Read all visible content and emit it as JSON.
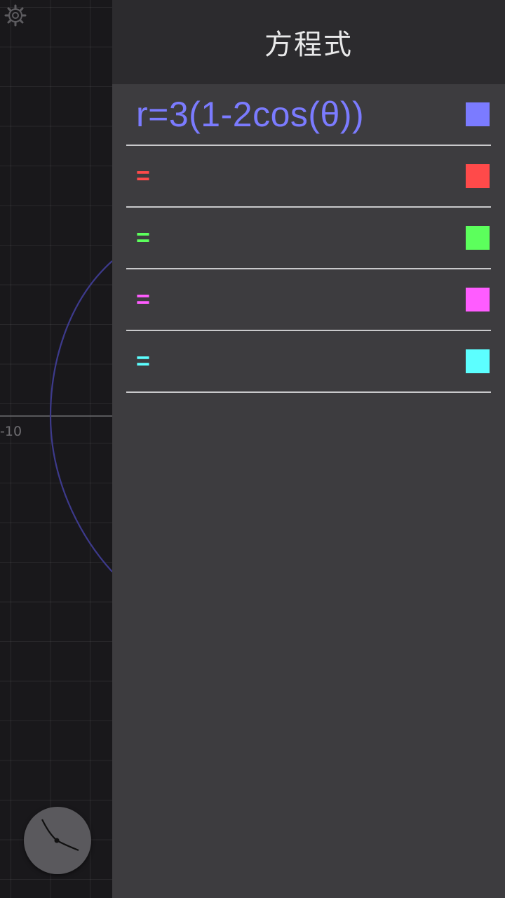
{
  "graph": {
    "axis_label": "-10",
    "curve_color": "#3d3a8c"
  },
  "icons": {
    "settings": "gear-icon",
    "fab": "clock-icon"
  },
  "drawer": {
    "title": "方程式",
    "equations": [
      {
        "text": "r=3(1-2cos(θ))",
        "color": "#7b7bff"
      },
      {
        "text": "=",
        "color": "#ff4a4a"
      },
      {
        "text": "=",
        "color": "#5cff5c"
      },
      {
        "text": "=",
        "color": "#ff5cff"
      },
      {
        "text": "=",
        "color": "#5cffff"
      }
    ]
  }
}
